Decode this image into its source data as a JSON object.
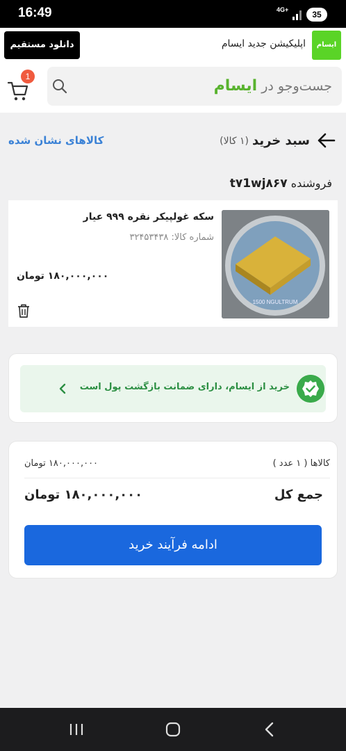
{
  "status_bar": {
    "time": "16:49",
    "network": "4G+",
    "battery": "35"
  },
  "app_banner": {
    "download_label": "دانلود مستقیم",
    "text": "اپلیکیشن جدید ایسام",
    "logo_text": "ایسام"
  },
  "header": {
    "search_prefix": "جست‌وجو در",
    "search_brand": "ایسام",
    "cart_badge": "1"
  },
  "cart": {
    "title": "سبد خرید",
    "count": "(۱ کالا)",
    "shown_items_link": "کالاهای نشان شده"
  },
  "seller": {
    "label": "فروشنده",
    "id": "t۷1wj۸۶۷"
  },
  "product": {
    "name": "سکه غولپیکر نقره ۹۹۹ عیار",
    "code": "شماره کالا: ۳۲۴۵۳۴۳۸",
    "price": "۱۸۰,۰۰۰,۰۰۰ تومان",
    "image_caption": "1500 NGULTRUM"
  },
  "guarantee": {
    "text": "خرید از ایسام، دارای ضمانت بازگشت پول است"
  },
  "summary": {
    "items_label": "کالاها ( ۱ عدد )",
    "items_value": "۱۸۰,۰۰۰,۰۰۰ تومان",
    "total_label": "جمع کل",
    "total_value": "۱۸۰,۰۰۰,۰۰۰ تومان",
    "continue_label": "ادامه فرآیند خرید"
  },
  "colors": {
    "brand_green": "#59b32f",
    "primary_blue": "#1a68de",
    "link_blue": "#3b82d6",
    "guarantee_green": "#2c8f43",
    "badge_red": "#f05a3e"
  },
  "icons": [
    "cart-icon",
    "search-icon",
    "back-arrow-icon",
    "trash-icon",
    "shield-check-icon",
    "chevron-left-icon",
    "nav-recents-icon",
    "nav-home-icon",
    "nav-back-icon"
  ]
}
